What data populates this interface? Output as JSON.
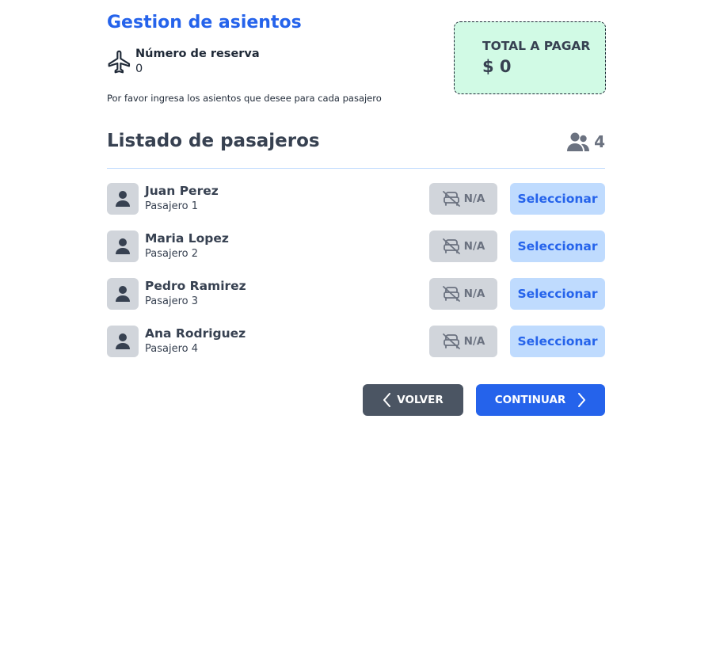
{
  "header": {
    "title": "Gestion de asientos",
    "reserva_label": "Número de reserva",
    "reserva_value": "0",
    "instructions": "Por favor ingresa los asientos que desee para cada pasajero"
  },
  "total": {
    "label": "TOTAL A PAGAR",
    "value": "$ 0",
    "background": "#d1fae5"
  },
  "list": {
    "title": "Listado de pasajeros",
    "count": "4",
    "passengers": [
      {
        "name": "Juan Perez",
        "label": "Pasajero 1",
        "seat": "N/A",
        "action": "Seleccionar"
      },
      {
        "name": "Maria Lopez",
        "label": "Pasajero 2",
        "seat": "N/A",
        "action": "Seleccionar"
      },
      {
        "name": "Pedro Ramirez",
        "label": "Pasajero 3",
        "seat": "N/A",
        "action": "Seleccionar"
      },
      {
        "name": "Ana Rodriguez",
        "label": "Pasajero 4",
        "seat": "N/A",
        "action": "Seleccionar"
      }
    ]
  },
  "actions": {
    "back_label": "VOLVER",
    "next_label": "CONTINUAR"
  },
  "icons": {
    "reserva": "plane-icon",
    "count": "users-icon",
    "avatar": "user-icon",
    "seat": "seat-unavailable-icon",
    "back": "chevron-left-icon",
    "next": "chevron-right-icon"
  },
  "colors": {
    "primary": "#2563eb",
    "select_bg": "#bfdbfe",
    "back_bg": "#4b5563",
    "badge_bg": "#d1d5db"
  }
}
